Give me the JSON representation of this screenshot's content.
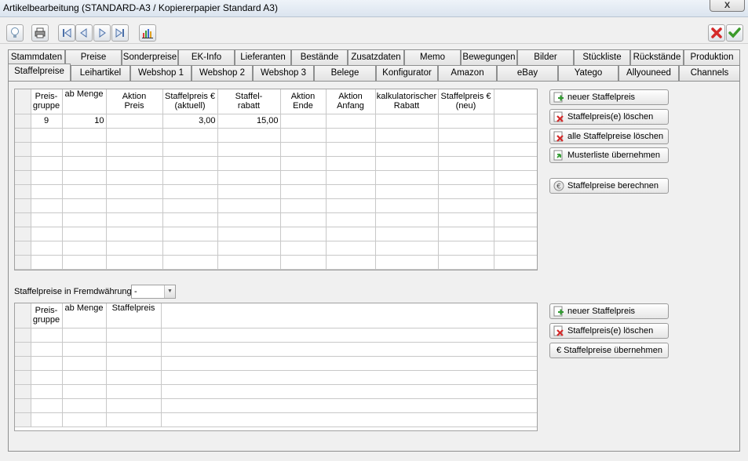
{
  "window": {
    "title": "Artikelbearbeitung (STANDARD-A3 / Kopiererpapier Standard A3)",
    "close_label": "X"
  },
  "toolbar": {
    "icons": [
      "lightbulb-icon",
      "printer-icon",
      "first-record-icon",
      "previous-record-icon",
      "next-record-icon",
      "last-record-icon",
      "chart-icon",
      "cancel-icon",
      "confirm-icon"
    ]
  },
  "tabs": {
    "row1": [
      "Stammdaten",
      "Preise",
      "Sonderpreise",
      "EK-Info",
      "Lieferanten",
      "Bestände",
      "Zusatzdaten",
      "Memo",
      "Bewegungen",
      "Bilder",
      "Stückliste",
      "Rückstände",
      "Produktion"
    ],
    "row2": [
      "Staffelpreise",
      "Leihartikel",
      "Webshop 1",
      "Webshop 2",
      "Webshop 3",
      "Belege",
      "Konfigurator",
      "Amazon",
      "eBay",
      "Yatego",
      "Allyouneed",
      "Channels"
    ],
    "active": "Staffelpreise"
  },
  "staffel_table": {
    "headers": [
      "Preis-\ngruppe",
      "ab Menge",
      "Aktion\nPreis",
      "Staffelpreis €\n(aktuell)",
      "Staffel-\nrabatt",
      "Aktion\nEnde",
      "Aktion\nAnfang",
      "kalkulatorischer\nRabatt",
      "Staffelpreis €\n(neu)"
    ],
    "rows": [
      [
        "9",
        "10",
        "",
        "3,00",
        "15,00",
        "",
        "",
        "",
        ""
      ]
    ]
  },
  "staffel_buttons": {
    "new": "neuer Staffelpreis",
    "delete": "Staffelpreis(e) löschen",
    "delete_all": "alle Staffelpreise löschen",
    "template": "Musterliste übernehmen",
    "calculate": "Staffelpreise berechnen"
  },
  "foreign": {
    "label": "Staffelpreise in Fremdwährung",
    "currency_value": "-",
    "headers": [
      "Preis-\ngruppe",
      "ab Menge",
      "Staffelpreis"
    ],
    "buttons": {
      "new": "neuer Staffelpreis",
      "delete": "Staffelpreis(e) löschen",
      "apply": "€ Staffelpreise übernehmen"
    }
  }
}
